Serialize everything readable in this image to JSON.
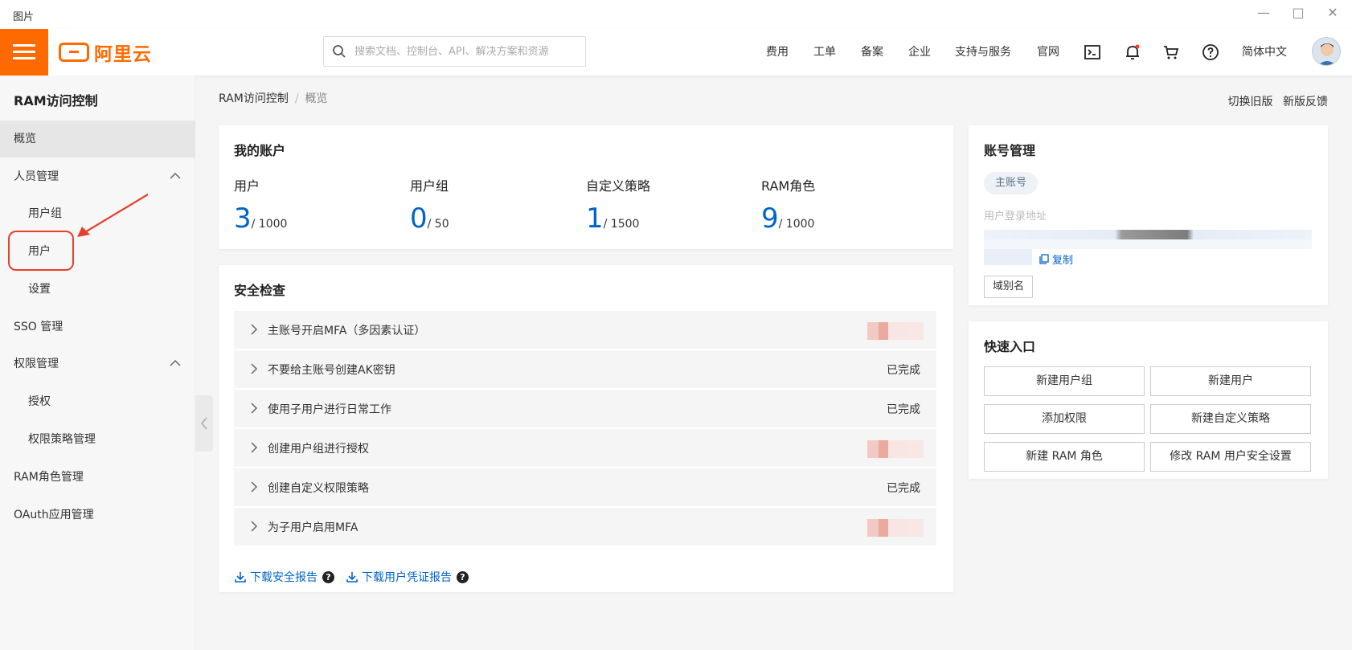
{
  "window": {
    "title": "图片"
  },
  "header": {
    "logo_text": "阿里云",
    "search_placeholder": "搜索文档、控制台、API、解决方案和资源",
    "nav": [
      "费用",
      "工单",
      "备案",
      "企业",
      "支持与服务",
      "官网"
    ],
    "language": "简体中文"
  },
  "sidebar": {
    "title": "RAM访问控制",
    "items": [
      "概览",
      "人员管理",
      "用户组",
      "用户",
      "设置",
      "SSO 管理",
      "权限管理",
      "授权",
      "权限策略管理",
      "RAM角色管理",
      "OAuth应用管理"
    ]
  },
  "breadcrumb": {
    "root": "RAM访问控制",
    "sep": "/",
    "current": "概览"
  },
  "top_links": [
    "切换旧版",
    "新版反馈"
  ],
  "account": {
    "title": "我的账户",
    "stats": [
      {
        "label": "用户",
        "value": "3",
        "limit": "/ 1000"
      },
      {
        "label": "用户组",
        "value": "0",
        "limit": "/ 50"
      },
      {
        "label": "自定义策略",
        "value": "1",
        "limit": "/ 1500"
      },
      {
        "label": "RAM角色",
        "value": "9",
        "limit": "/ 1000"
      }
    ]
  },
  "security": {
    "title": "安全检查",
    "checks": [
      {
        "label": "主账号开启MFA（多因素认证）",
        "status": ""
      },
      {
        "label": "不要给主账号创建AK密钥",
        "status": "已完成"
      },
      {
        "label": "使用子用户进行日常工作",
        "status": "已完成"
      },
      {
        "label": "创建用户组进行授权",
        "status": ""
      },
      {
        "label": "创建自定义权限策略",
        "status": "已完成"
      },
      {
        "label": "为子用户启用MFA",
        "status": ""
      }
    ],
    "download_report": "下载安全报告",
    "download_credential_report": "下载用户凭证报告",
    "help_glyph": "?"
  },
  "account_mgmt": {
    "title": "账号管理",
    "tag": "主账号",
    "login_url_label": "用户登录地址",
    "copy": "复制",
    "alias": "域别名"
  },
  "quick": {
    "title": "快速入口",
    "buttons": [
      "新建用户组",
      "新建用户",
      "添加权限",
      "新建自定义策略",
      "新建 RAM 角色",
      "修改 RAM 用户安全设置"
    ]
  },
  "colors": {
    "brand": "#ff6a00",
    "link": "#0064c8",
    "annotation": "#e5402b"
  }
}
